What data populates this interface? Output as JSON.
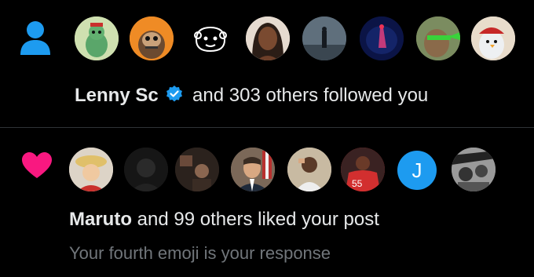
{
  "colors": {
    "person_icon": "#1d9bf0",
    "heart_icon": "#f91880",
    "verified_badge": "#1d9bf0",
    "avatar_j_bg": "#1d9bf0"
  },
  "follow_notification": {
    "icon": "person-icon",
    "actor": "Lenny Sc",
    "verified": true,
    "text": "and 303 others followed you",
    "avatar_count": 8
  },
  "like_notification": {
    "icon": "heart-icon",
    "actor": "Maruto",
    "text": "and 99 others liked your post",
    "post_preview": "Your fourth emoji is your response",
    "avatar_j_letter": "J",
    "avatar_count": 8
  }
}
